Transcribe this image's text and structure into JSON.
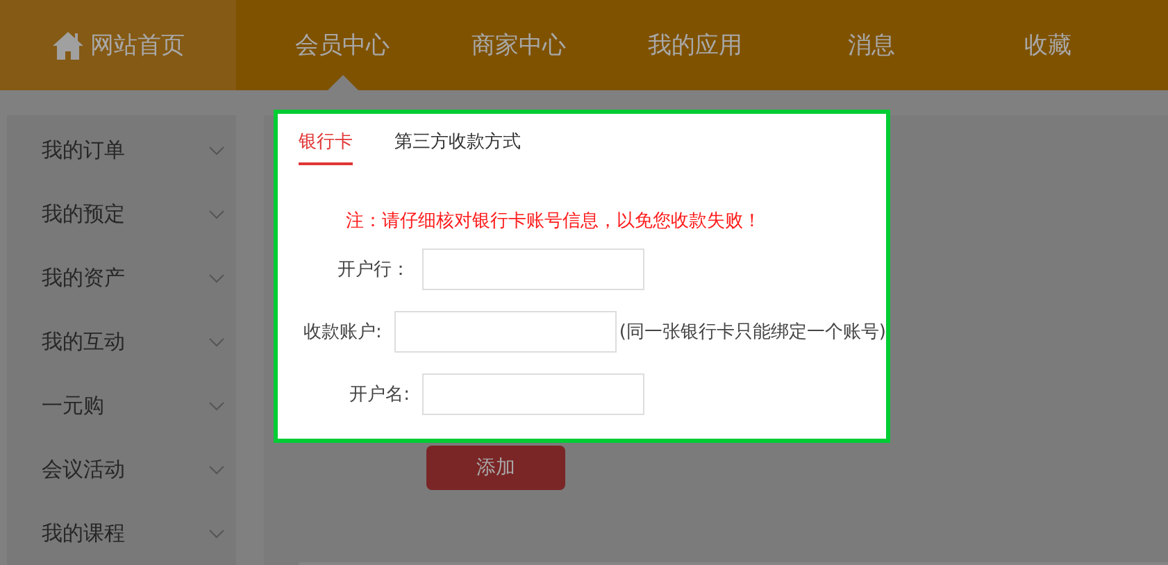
{
  "nav": {
    "home": "网站首页",
    "items": [
      {
        "label": "会员中心",
        "selected": true
      },
      {
        "label": "商家中心",
        "selected": false
      },
      {
        "label": "我的应用",
        "selected": false
      },
      {
        "label": "消息",
        "selected": false
      },
      {
        "label": "收藏",
        "selected": false
      }
    ]
  },
  "sidebar": {
    "items": [
      "我的订单",
      "我的预定",
      "我的资产",
      "我的互动",
      "一元购",
      "会议活动",
      "我的课程"
    ]
  },
  "panel": {
    "tabs": [
      {
        "label": "银行卡",
        "selected": true
      },
      {
        "label": "第三方收款方式",
        "selected": false
      }
    ],
    "notice": "注：请仔细核对银行卡账号信息，以免您收款失败！",
    "fields": [
      {
        "label": "开户行："
      },
      {
        "label": "收款账户:",
        "hint": "(同一张银行卡只能绑定一个账号)"
      },
      {
        "label": "开户名:"
      }
    ]
  },
  "add_button": "添加"
}
